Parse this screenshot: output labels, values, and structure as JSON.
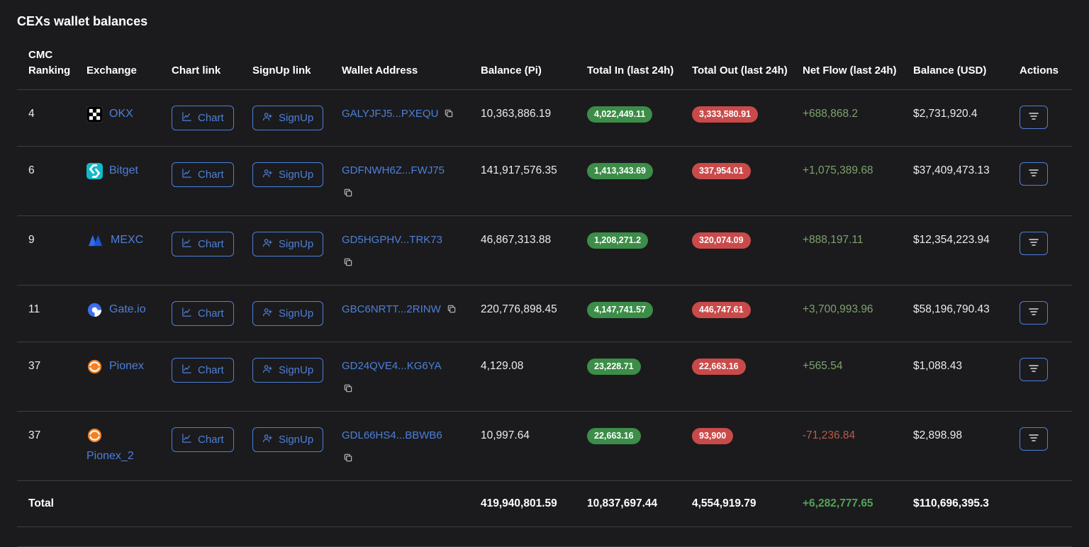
{
  "title": "CEXs wallet balances",
  "colors": {
    "background": "#1b1b1d",
    "accent_blue": "#4d7fd9",
    "badge_green": "#3c8d48",
    "badge_red": "#ca4a4a",
    "positive_green": "#7da26d",
    "negative_red": "#b85b4c",
    "total_positive_green": "#53a257"
  },
  "icons": {
    "chart_button": "line-chart-icon",
    "signup_button": "user-plus-icon",
    "copy": "copy-icon",
    "actions": "filter-icon"
  },
  "table": {
    "headers": {
      "ranking": "CMC Ranking",
      "exchange": "Exchange",
      "chart": "Chart link",
      "signup": "SignUp link",
      "wallet": "Wallet Address",
      "balance_pi": "Balance (Pi)",
      "total_in": "Total In (last 24h)",
      "total_out": "Total Out (last 24h)",
      "net_flow": "Net Flow (last 24h)",
      "balance_usd": "Balance (USD)",
      "actions": "Actions"
    },
    "buttons": {
      "chart": "Chart",
      "signup": "SignUp"
    },
    "rows": [
      {
        "ranking": "4",
        "exchange": "OKX",
        "wallet": "GALYJFJ5...PXEQU",
        "balance_pi": "10,363,886.19",
        "total_in": "4,022,449.11",
        "total_out": "3,333,580.91",
        "net_flow": "+688,868.2",
        "balance_usd": "$2,731,920.4"
      },
      {
        "ranking": "6",
        "exchange": "Bitget",
        "wallet": "GDFNWH6Z...FWJ75",
        "balance_pi": "141,917,576.35",
        "total_in": "1,413,343.69",
        "total_out": "337,954.01",
        "net_flow": "+1,075,389.68",
        "balance_usd": "$37,409,473.13"
      },
      {
        "ranking": "9",
        "exchange": "MEXC",
        "wallet": "GD5HGPHV...TRK73",
        "balance_pi": "46,867,313.88",
        "total_in": "1,208,271.2",
        "total_out": "320,074.09",
        "net_flow": "+888,197.11",
        "balance_usd": "$12,354,223.94"
      },
      {
        "ranking": "11",
        "exchange": "Gate.io",
        "wallet": "GBC6NRTT...2RINW",
        "balance_pi": "220,776,898.45",
        "total_in": "4,147,741.57",
        "total_out": "446,747.61",
        "net_flow": "+3,700,993.96",
        "balance_usd": "$58,196,790.43"
      },
      {
        "ranking": "37",
        "exchange": "Pionex",
        "wallet": "GD24QVE4...KG6YA",
        "balance_pi": "4,129.08",
        "total_in": "23,228.71",
        "total_out": "22,663.16",
        "net_flow": "+565.54",
        "balance_usd": "$1,088.43"
      },
      {
        "ranking": "37",
        "exchange": "Pionex_2",
        "wallet": "GDL66HS4...BBWB6",
        "balance_pi": "10,997.64",
        "total_in": "22,663.16",
        "total_out": "93,900",
        "net_flow": "-71,236.84",
        "balance_usd": "$2,898.98"
      }
    ],
    "total": {
      "label": "Total",
      "balance_pi": "419,940,801.59",
      "total_in": "10,837,697.44",
      "total_out": "4,554,919.79",
      "net_flow": "+6,282,777.65",
      "balance_usd": "$110,696,395.3"
    }
  }
}
